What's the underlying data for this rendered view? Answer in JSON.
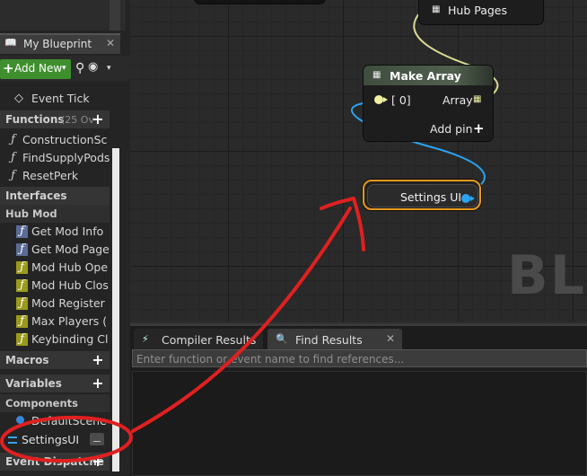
{
  "panel": {
    "tab_title": "My Blueprint",
    "close_glyph": "✕",
    "add_new_label": "Add New",
    "add_new_plus": "+",
    "caret": "▾",
    "search_glyph": "⚲",
    "eye_glyph": "👁"
  },
  "tree": {
    "event_tick": "Event Tick",
    "functions": {
      "label": "Functions",
      "count": "(25 Ov",
      "add": "+"
    },
    "function_items": [
      "ConstructionSc",
      "FindSupplyPods",
      "ResetPerk"
    ],
    "interfaces": {
      "label": "Interfaces"
    },
    "hub_mod": {
      "label": "Hub Mod"
    },
    "hub_mod_items": [
      "Get Mod Info",
      "Get Mod Page",
      "Mod Hub Ope",
      "Mod Hub Clos",
      "Mod Register",
      "Max Players (",
      "Keybinding Cl"
    ],
    "macros": {
      "label": "Macros",
      "add": "+"
    },
    "variables": {
      "label": "Variables",
      "add": "+"
    },
    "components": {
      "label": "Components"
    },
    "component_items": [
      "DefaultScene",
      "SettingsUI"
    ],
    "event_dispatchers": {
      "label": "Event Dispatche",
      "add": "+"
    }
  },
  "graph": {
    "watermark": "BLU",
    "hub_node": {
      "title": "Hub Pages"
    },
    "make_array": {
      "title": "Make Array",
      "input_pin": "[ 0]",
      "output_pin": "Array",
      "add_pin": "Add pin",
      "add_pin_glyph": "+"
    },
    "settings_node": {
      "title": "Settings UI"
    }
  },
  "bottom": {
    "tabs": [
      {
        "label": "Compiler Results"
      },
      {
        "label": "Find Results",
        "close": "✕"
      }
    ],
    "find_placeholder": "Enter function or event name to find references..."
  },
  "colors": {
    "annotation": "#e02020",
    "selection": "#e89a1e",
    "object_pin": "#2aa3f0",
    "array_pin": "#f0f0a0",
    "add_new": "#3f8f2e"
  }
}
